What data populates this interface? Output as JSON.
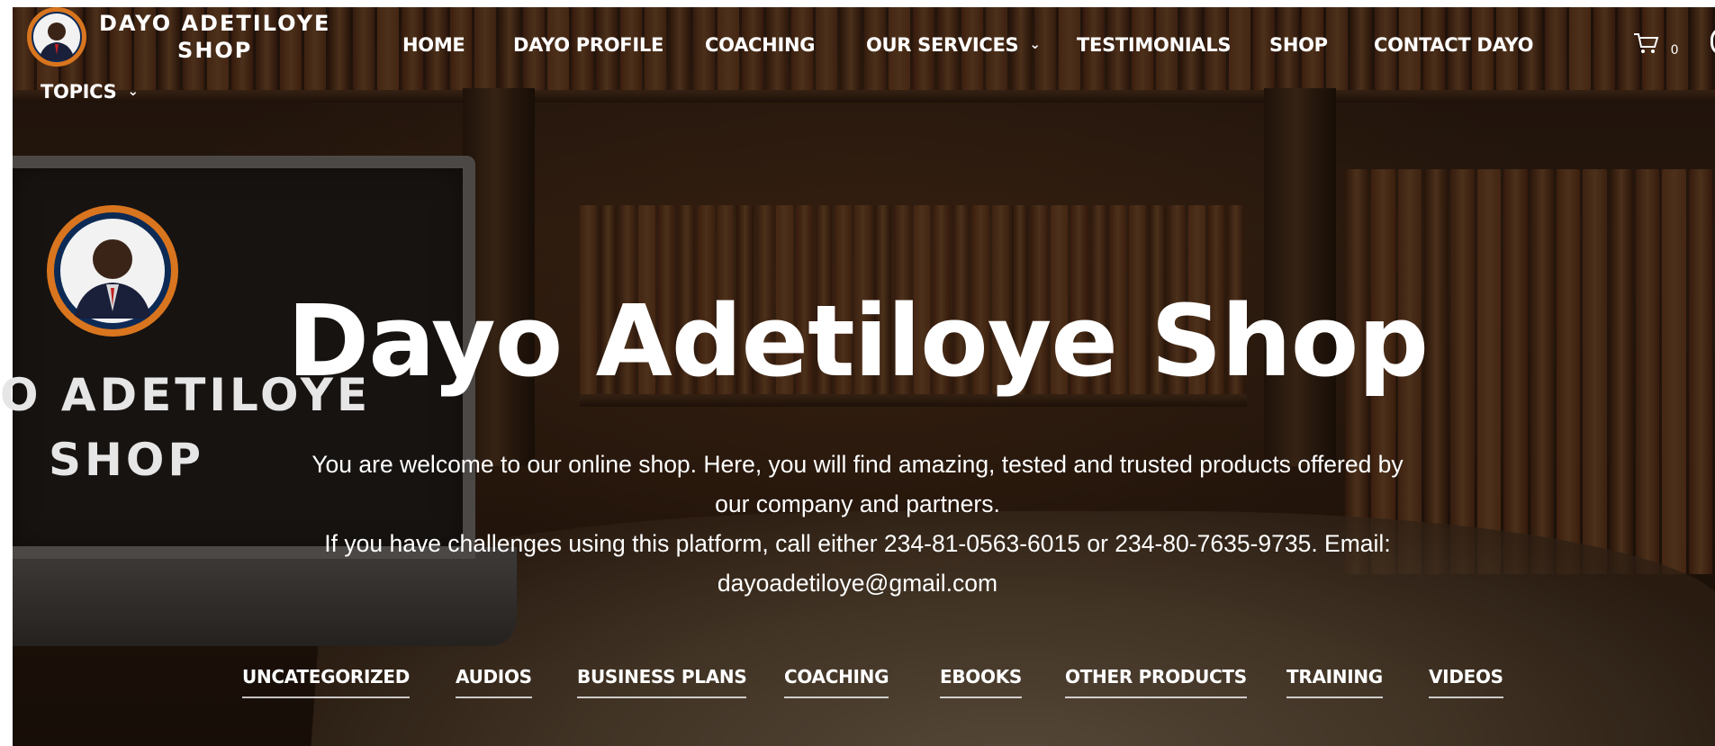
{
  "brand": {
    "line1": "DAYO ADETILOYE",
    "line2": "SHOP"
  },
  "nav": {
    "home": "HOME",
    "profile": "DAYO PROFILE",
    "coaching": "COACHING",
    "services": "OUR SERVICES",
    "testimonials": "TESTIMONIALS",
    "shop": "SHOP",
    "contact": "CONTACT DAYO",
    "topics": "TOPICS"
  },
  "cart": {
    "count": "0"
  },
  "hero": {
    "title": "Dayo Adetiloye Shop",
    "desc_line1": "You are welcome to our online shop. Here, you will find amazing, tested and trusted products offered by",
    "desc_line2": "our company and partners.",
    "desc_line3": "If you have challenges using this platform, call either 234-81-0563-6015 or 234-80-7635-9735. Email:",
    "desc_line4": "dayoadetiloye@gmail.com",
    "laptop_text1": "O ADETILOYE",
    "laptop_text2": "SHOP"
  },
  "categories": [
    "UNCATEGORIZED",
    "AUDIOS",
    "BUSINESS PLANS",
    "COACHING",
    "EBOOKS",
    "OTHER PRODUCTS",
    "TRAINING",
    "VIDEOS"
  ],
  "icons": {
    "cart": "shopping-cart-icon",
    "chevron": "chevron-down-icon",
    "search": "search-icon"
  }
}
